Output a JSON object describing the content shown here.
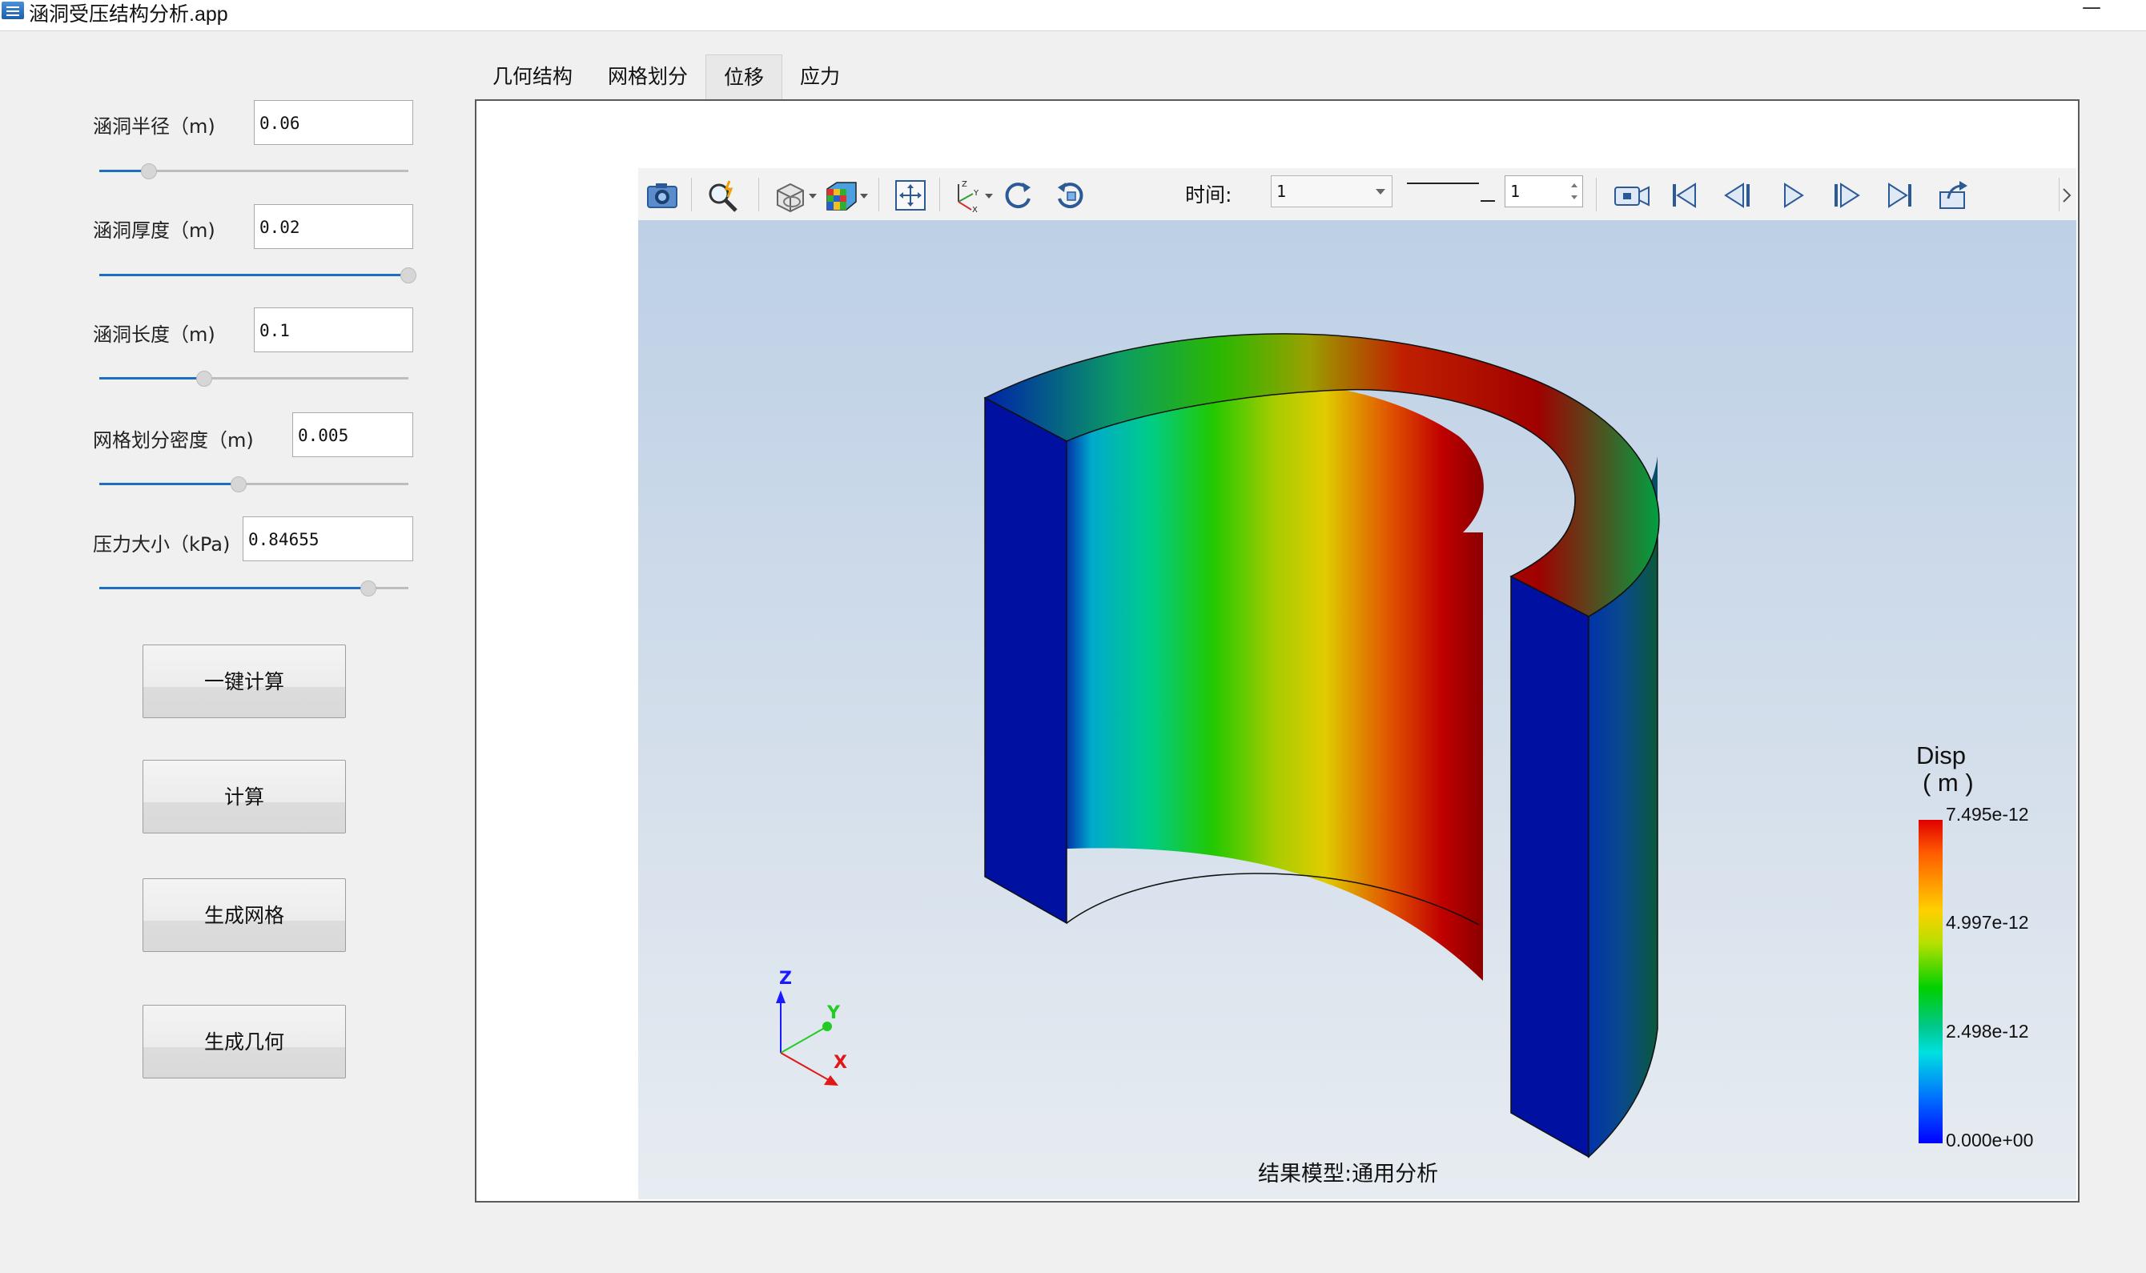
{
  "window": {
    "title": "涵洞受压结构分析.app",
    "minimize_glyph": "—"
  },
  "params": [
    {
      "label": "涵洞半径（m)",
      "value": "0.06",
      "slider_fraction": 0.16
    },
    {
      "label": "涵洞厚度（m)",
      "value": "0.02",
      "slider_fraction": 1.0
    },
    {
      "label": "涵洞长度（m)",
      "value": "0.1",
      "slider_fraction": 0.34
    },
    {
      "label": "网格划分密度（m)",
      "value": "0.005",
      "slider_fraction": 0.45
    },
    {
      "label": "压力大小（kPa)",
      "value": "0.84655",
      "slider_fraction": 0.87
    }
  ],
  "buttons": {
    "one_click": "一键计算",
    "compute": "计算",
    "mesh": "生成网格",
    "geometry": "生成几何"
  },
  "tabs": [
    "几何结构",
    "网格划分",
    "位移",
    "应力"
  ],
  "active_tab": "位移",
  "toolbar": {
    "time_label": "时间:",
    "time_value": "1",
    "step_value": "1",
    "icons": [
      "camera-icon",
      "zoom-icon",
      "display-mode-icon",
      "mesh-color-icon",
      "fit-view-icon",
      "axes-icon",
      "rotate-icon",
      "reset-view-icon",
      "record-icon",
      "first-frame-icon",
      "prev-frame-icon",
      "play-icon",
      "next-frame-icon",
      "last-frame-icon",
      "export-icon"
    ]
  },
  "viewport": {
    "result_model": "结果模型:通用分析",
    "axis_labels": {
      "z": "Z",
      "y": "Y",
      "x": "X"
    }
  },
  "legend": {
    "title": "Disp",
    "unit": "( m )",
    "labels": [
      "7.495e-12",
      "4.997e-12",
      "2.498e-12",
      "0.000e+00"
    ]
  },
  "colors": {
    "accent": "#1f6fbf",
    "legend_max": "#e00000",
    "legend_min": "#0000ff"
  }
}
